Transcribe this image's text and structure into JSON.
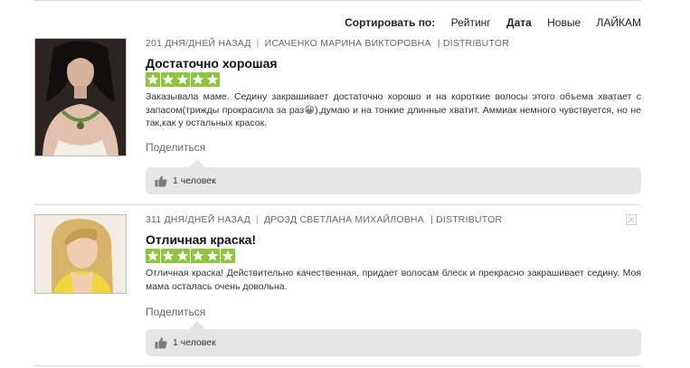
{
  "sort": {
    "label": "Сортировать по:",
    "options": [
      "Рейтинг",
      "Дата",
      "Новые",
      "ЛАЙКАМ"
    ],
    "active": "Дата"
  },
  "reviews": [
    {
      "days_ago": "201 ДНЯ/ДНЕЙ НАЗАД",
      "author": "ИСАЧЕНКО МАРИНА ВИКТОРОВНА",
      "role": "| DISTRIBUTOR",
      "title": "Достаточно хорошая",
      "rating": 5,
      "text": "Заказывала маме. Седину закрашивает достаточно хорошо и на короткие волосы этого объема хватает с запасом(трижды прокрасила за раз😀),думаю и на тонкие длинные хватит. Аммиак немного чувствуется, но не так,как у остальных красок.",
      "share": "Поделиться",
      "likes": "1 человек"
    },
    {
      "days_ago": "311 ДНЯ/ДНЕЙ НАЗАД",
      "author": "ДРОЗД СВЕТЛАНА МИХАЙЛОВНА",
      "role": "| DISTRIBUTOR",
      "title": "Отличная краска!",
      "rating": 5,
      "text": "Отличная краска! Действительно качественная, придает волосам блеск и прекрасно закрашивает седину. Моя мама осталась очень довольна.",
      "share": "Поделиться",
      "likes": "1 человек"
    }
  ],
  "colors": {
    "star": "#8cc63f",
    "like_box": "#e6e6e6",
    "divider": "#dcdcdc"
  },
  "icons": {
    "star": "star-icon",
    "like": "thumbs-up-icon",
    "close": "close-icon"
  }
}
